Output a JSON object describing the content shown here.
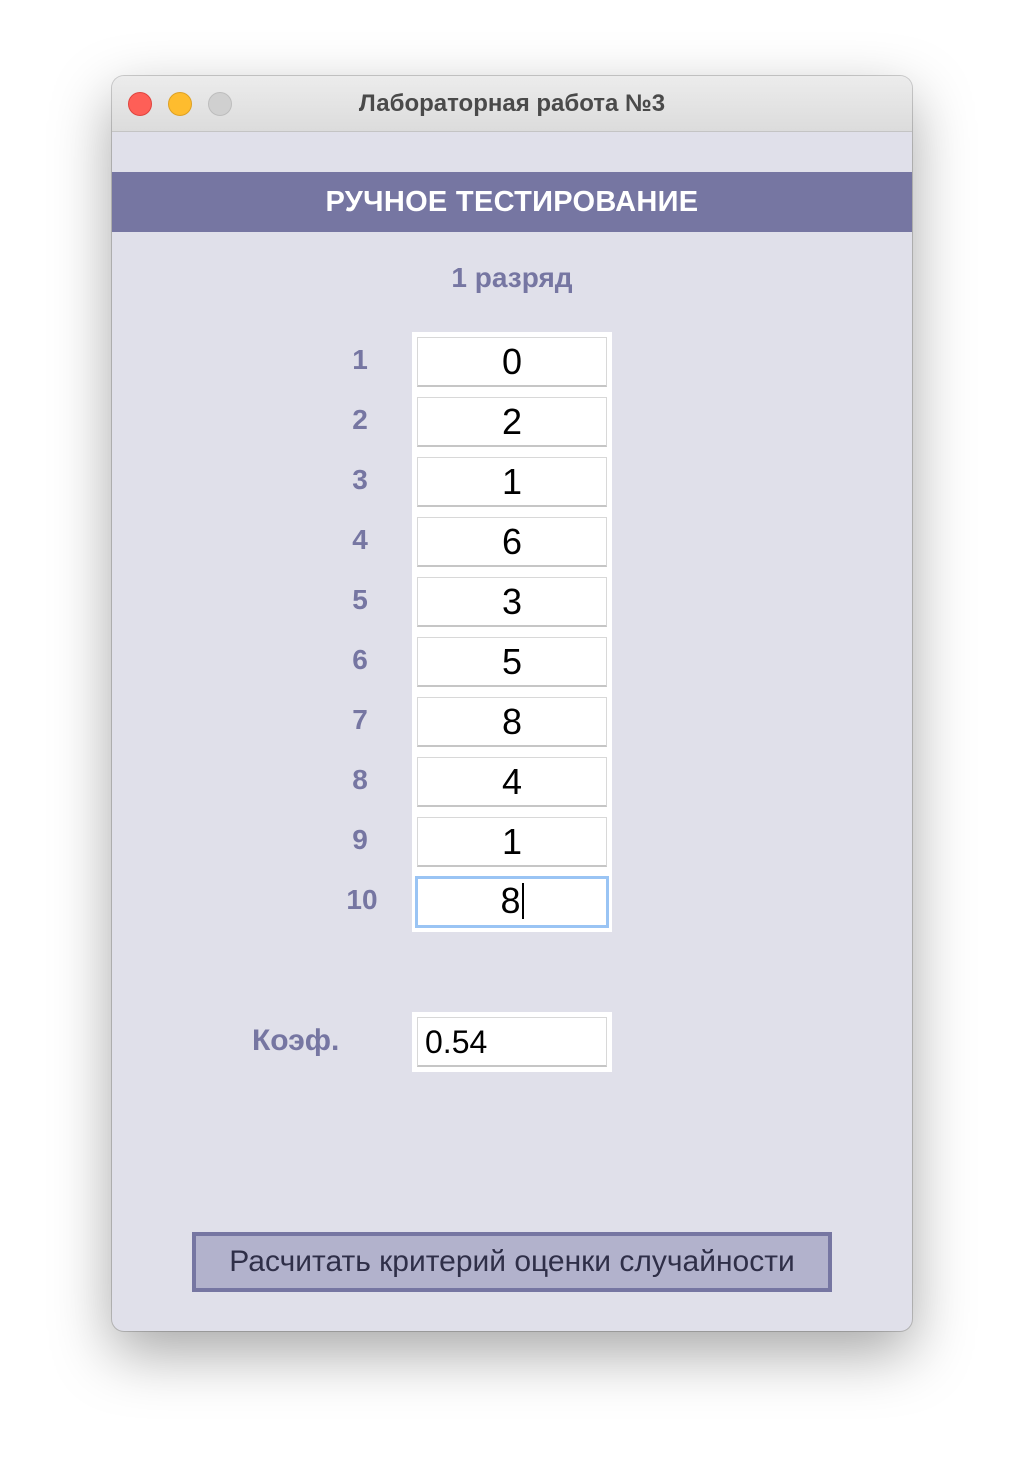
{
  "window": {
    "title": "Лабораторная работа №3"
  },
  "banner": {
    "title": "РУЧНОЕ ТЕСТИРОВАНИЕ"
  },
  "digit_heading": "1 разряд",
  "rows": [
    {
      "label": "1",
      "value": "0"
    },
    {
      "label": "2",
      "value": "2"
    },
    {
      "label": "3",
      "value": "1"
    },
    {
      "label": "4",
      "value": "6"
    },
    {
      "label": "5",
      "value": "3"
    },
    {
      "label": "6",
      "value": "5"
    },
    {
      "label": "7",
      "value": "8"
    },
    {
      "label": "8",
      "value": "4"
    },
    {
      "label": "9",
      "value": "1"
    },
    {
      "label": "10",
      "value": "8"
    }
  ],
  "coefficient": {
    "label": "Коэф.",
    "value": "0.54"
  },
  "calculate_button": {
    "label": "Расчитать критерий оценки случайности"
  },
  "colors": {
    "accent": "#7676a2",
    "background": "#e0e0ea",
    "button_fill": "#b2b2cc",
    "focus_ring": "#9ac4f4"
  },
  "icons": {
    "close": "close-icon",
    "minimize": "minimize-icon",
    "zoom": "zoom-icon"
  }
}
